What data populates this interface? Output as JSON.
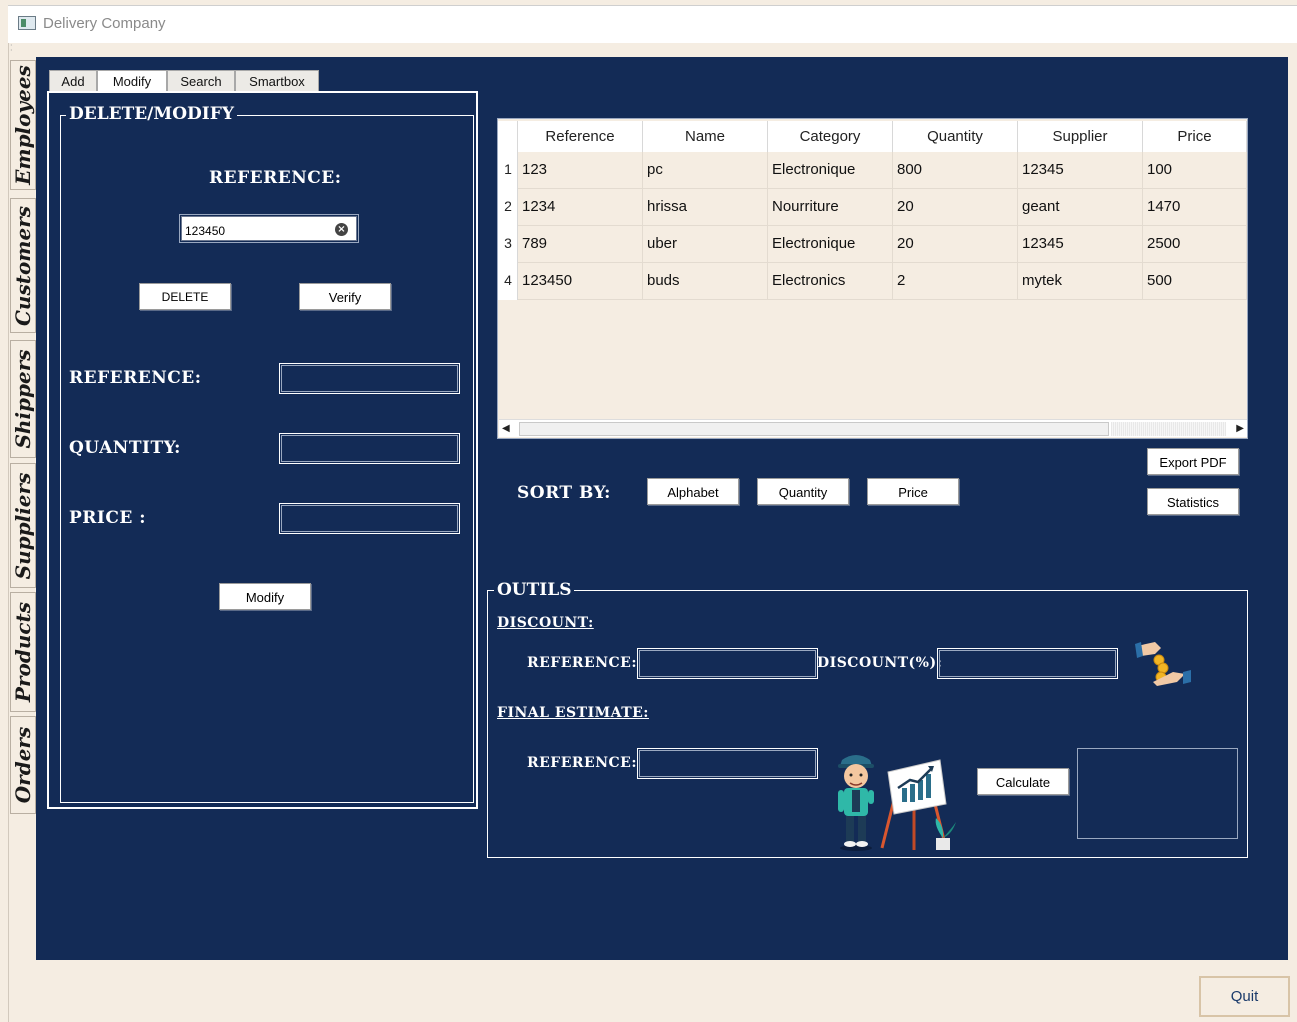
{
  "window": {
    "title": "Delivery Company"
  },
  "side_tabs": [
    "Employees",
    "Customers",
    "Shippers",
    "Suppliers",
    "Products",
    "Orders"
  ],
  "top_tabs": [
    "Add",
    "Modify",
    "Search",
    "Smartbox"
  ],
  "active_top_tab": "Modify",
  "delete_panel": {
    "legend": "DELETE/MODIFY",
    "reference_title": "REFERENCE:",
    "search_value": "123450",
    "delete_label": "DELETE",
    "verify_label": "Verify",
    "reference_label": "REFERENCE:",
    "quantity_label": "QUANTITY:",
    "price_label": "PRICE :",
    "modify_label": "Modify"
  },
  "table": {
    "columns": [
      "Reference",
      "Name",
      "Category",
      "Quantity",
      "Supplier",
      "Price"
    ],
    "rows": [
      {
        "n": "1",
        "cells": [
          "123",
          "pc",
          "Electronique",
          "800",
          "12345",
          "100"
        ]
      },
      {
        "n": "2",
        "cells": [
          "1234",
          "hrissa",
          "Nourriture",
          "20",
          "geant",
          "1470"
        ]
      },
      {
        "n": "3",
        "cells": [
          "789",
          "uber",
          "Electronique",
          "20",
          "12345",
          "2500"
        ]
      },
      {
        "n": "4",
        "cells": [
          "123450",
          "buds",
          "Electronics",
          "2",
          "mytek",
          "500"
        ]
      }
    ]
  },
  "sort": {
    "label": "SORT BY:",
    "alphabet": "Alphabet",
    "quantity": "Quantity",
    "price": "Price"
  },
  "actions": {
    "export_pdf": "Export PDF",
    "statistics": "Statistics"
  },
  "outils": {
    "legend": "OUTILS",
    "discount_heading": "DISCOUNT:",
    "discount_reference_label": "REFERENCE:",
    "discount_percent_label": "DISCOUNT(%):",
    "final_heading": "FINAL ESTIMATE:",
    "final_reference_label": "REFERENCE:",
    "calculate_label": "Calculate"
  },
  "quit_label": "Quit",
  "colors": {
    "main_bg": "#132b56",
    "window_bg": "#f5ede2",
    "table_bg": "#f5ede2"
  }
}
